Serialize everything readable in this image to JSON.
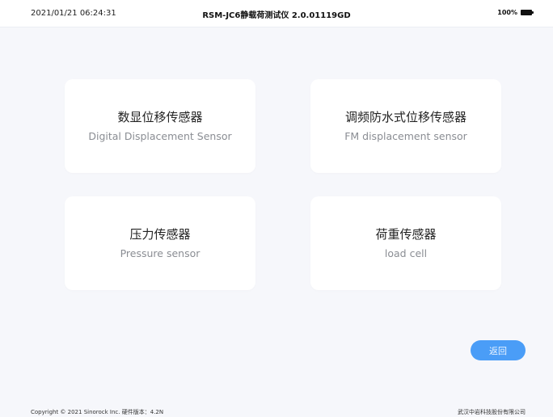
{
  "statusbar": {
    "datetime": "2021/01/21 06:24:31",
    "title": "RSM-JC6静载荷测试仪 2.0.01119GD",
    "battery_text": "100%",
    "battery_icon": "battery-full-icon"
  },
  "sensors": [
    {
      "title": "数显位移传感器",
      "subtitle": "Digital Displacement Sensor"
    },
    {
      "title": "调频防水式位移传感器",
      "subtitle": "FM displacement sensor"
    },
    {
      "title": "压力传感器",
      "subtitle": "Pressure sensor"
    },
    {
      "title": "荷重传感器",
      "subtitle": "load cell"
    }
  ],
  "back_button": {
    "label": "返回"
  },
  "footer": {
    "left": "Copyright © 2021 Sinorock Inc. 硬件版本：4.2N",
    "right": "武汉中岩科技股份有限公司"
  },
  "colors": {
    "background": "#f6f7fb",
    "card": "#ffffff",
    "accent": "#4a9df7"
  }
}
